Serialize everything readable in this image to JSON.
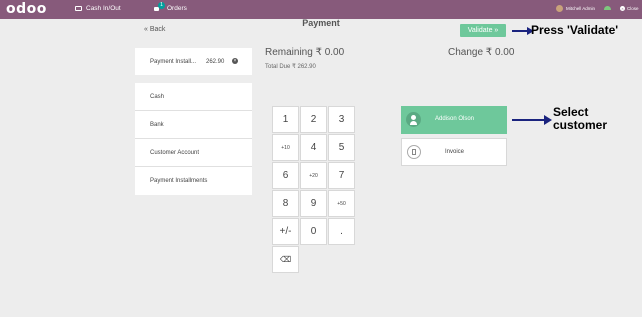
{
  "topbar": {
    "logo": "odoo",
    "cash_label": "Cash In/Out",
    "orders_label": "Orders",
    "orders_count": "1",
    "user_name": "Mitchell Admin",
    "close_label": "Close"
  },
  "screen": {
    "title": "Payment",
    "back_label": "« Back",
    "validate_label": "Validate »",
    "remaining": "Remaining ₹ 0.00",
    "total_due": "Total Due ₹ 262.90",
    "change": "Change ₹ 0.00"
  },
  "payment_line": {
    "method": "Payment Install...",
    "amount": "262.90"
  },
  "payment_methods": [
    "Cash",
    "Bank",
    "Customer Account",
    "Payment Installments"
  ],
  "numpad": {
    "keys": [
      "1",
      "2",
      "3",
      "+10",
      "4",
      "5",
      "+20",
      "6",
      "7",
      "+50",
      "8",
      "9",
      "+/-",
      "0",
      "."
    ],
    "backspace": "⌫"
  },
  "customer": {
    "name": "Addison Olson"
  },
  "invoice_label": "Invoice",
  "annotations": {
    "validate_note": "Press 'Validate'",
    "customer_note_1": "Select",
    "customer_note_2": "customer"
  },
  "colors": {
    "topbar": "#875a7b",
    "accent": "#6ec89b",
    "arrow": "#1a237e"
  }
}
